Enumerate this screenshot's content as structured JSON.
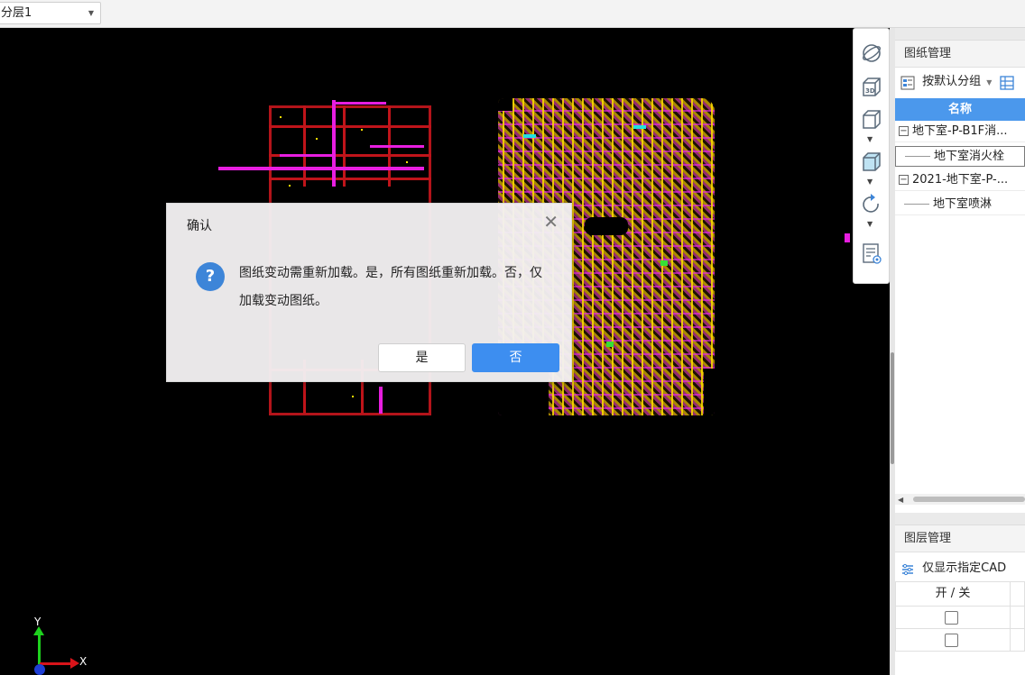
{
  "topbar": {
    "layer_select_value": "分层1"
  },
  "canvas": {
    "axis_y_label": "Y",
    "axis_x_label": "X"
  },
  "viewbar": {
    "icons": [
      "orbit-icon",
      "3d-view-icon",
      "cube-wireframe-icon",
      "cube-shaded-icon",
      "rotate-icon",
      "layer-visibility-icon"
    ]
  },
  "drawing_panel": {
    "title": "图纸管理",
    "group_button": "按默认分组",
    "column_name": "名称",
    "tree": [
      {
        "label": "地下室-P-B1F消...",
        "level": 0,
        "toggle": "−"
      },
      {
        "label": "地下室消火栓",
        "level": 1,
        "selected": true
      },
      {
        "label": "2021-地下室-P-...",
        "level": 0,
        "toggle": "−"
      },
      {
        "label": "地下室喷淋",
        "level": 1
      }
    ]
  },
  "layer_panel": {
    "title": "图层管理",
    "filter_button": "仅显示指定CAD",
    "column_on_off": "开 / 关"
  },
  "dialog": {
    "title": "确认",
    "close_glyph": "✕",
    "icon_glyph": "?",
    "message": "图纸变动需重新加载。是，所有图纸重新加载。否，仅加载变动图纸。",
    "yes_label": "是",
    "no_label": "否"
  },
  "colors": {
    "accent": "#3d8ef0",
    "tree_header": "#4b98ec",
    "cad_red": "#c0141a",
    "cad_magenta": "#e81ee0",
    "cad_yellow": "#ffdc00"
  }
}
